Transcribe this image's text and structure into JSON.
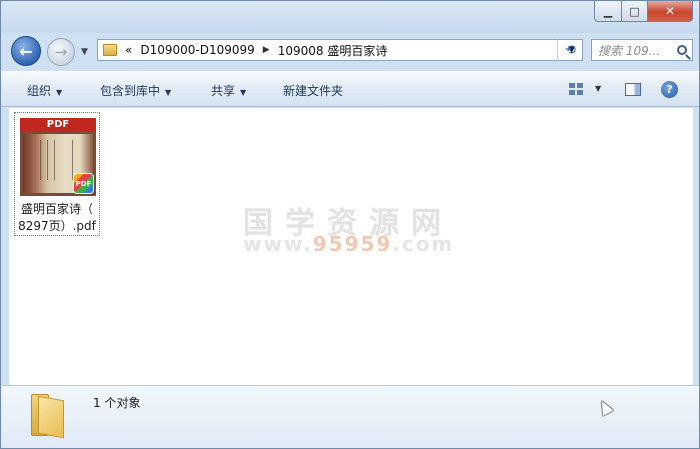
{
  "window": {
    "minimize_glyph": "▁",
    "maximize_glyph": "□",
    "close_glyph": "✕"
  },
  "nav": {
    "back_glyph": "←",
    "forward_glyph": "→",
    "dropdown_glyph": "▼",
    "address": {
      "overflow": "«",
      "segments": [
        "D109000-D109099",
        "109008 盛明百家诗"
      ],
      "separator": "▶",
      "dropdown_glyph": "▼"
    },
    "refresh_glyph": "⟲",
    "search_placeholder": "搜索 109..."
  },
  "toolbar": {
    "organize": "组织",
    "include_in_library": "包含到库中",
    "share": "共享",
    "new_folder": "新建文件夹",
    "dropdown_glyph": "▼",
    "help_glyph": "?"
  },
  "files": [
    {
      "name_line1": "盛明百家诗（",
      "name_line2": "8297页）.pdf",
      "thumb_label": "PDF",
      "badge_label": "PDF"
    }
  ],
  "watermark": {
    "line1": "国学资源网",
    "line2_prefix": "www.",
    "line2_highlight": "95959",
    "line2_suffix": ".com"
  },
  "details": {
    "count_text": "1 个对象"
  },
  "colors": {
    "close_red": "#c9462f",
    "accent_blue": "#2f64b4",
    "toolbar_text": "#1e395b"
  }
}
